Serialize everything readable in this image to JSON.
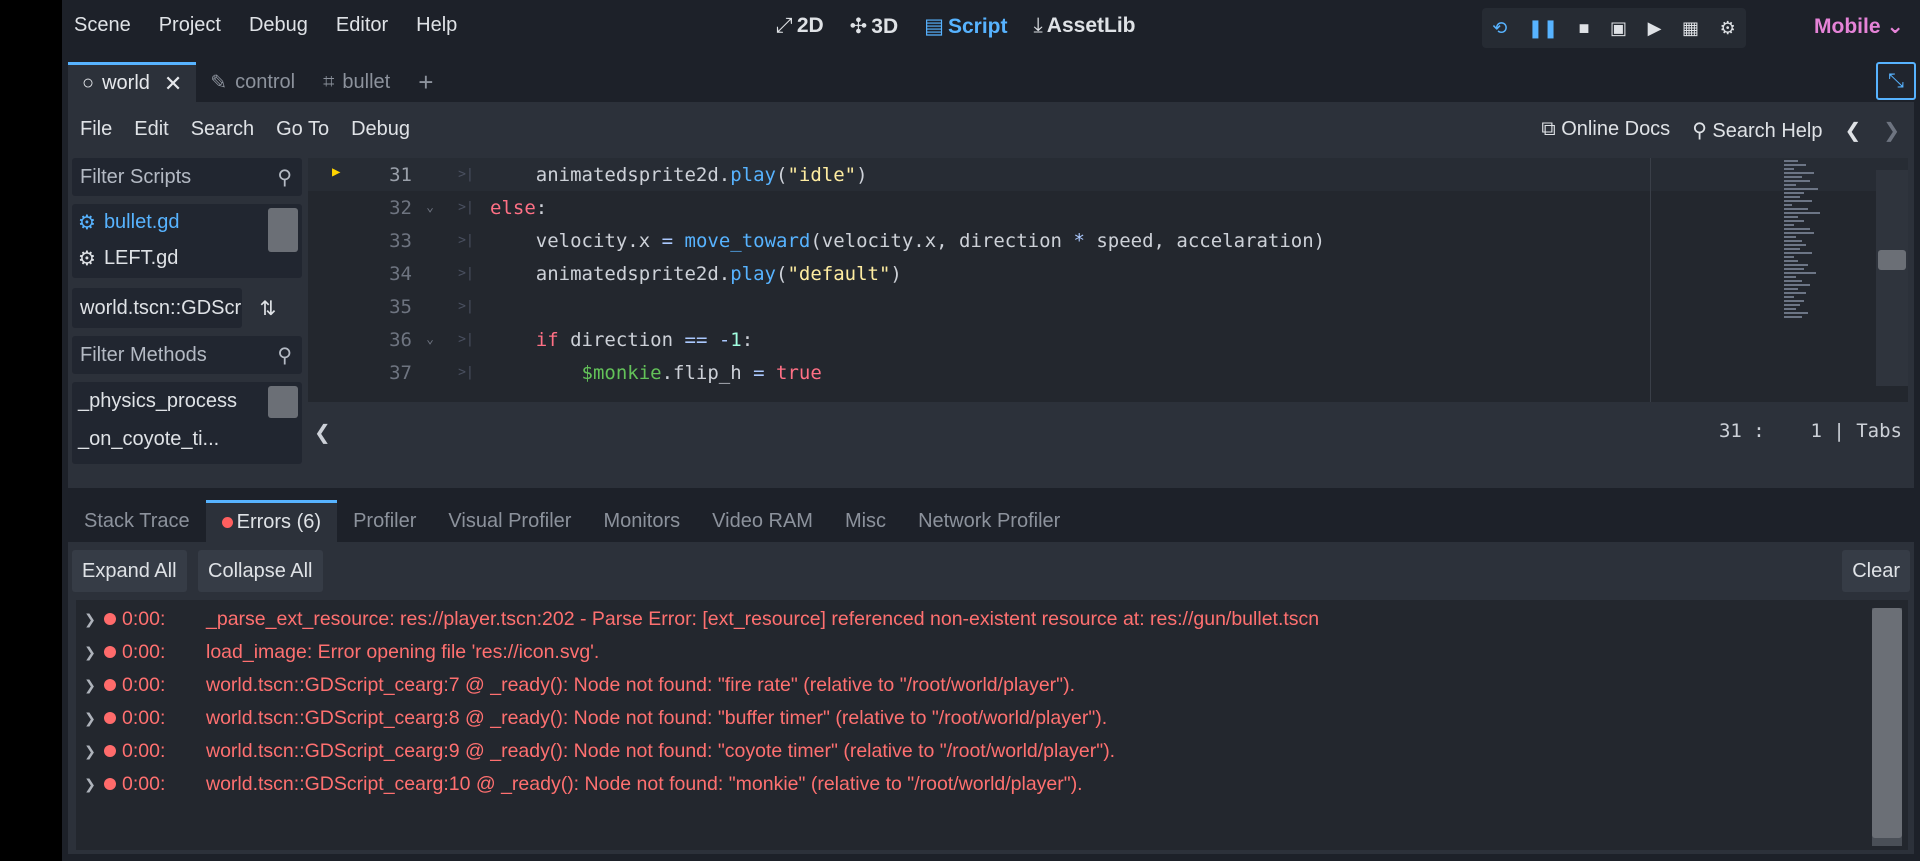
{
  "menu": [
    "Scene",
    "Project",
    "Debug",
    "Editor",
    "Help"
  ],
  "workspaces": [
    {
      "icon": "⤢",
      "label": "2D",
      "active": false
    },
    {
      "icon": "✣",
      "label": "3D",
      "active": false
    },
    {
      "icon": "▤",
      "label": "Script",
      "active": true
    },
    {
      "icon": "⤓",
      "label": "AssetLib",
      "active": false
    }
  ],
  "run_buttons": [
    "⟲",
    "❚❚",
    "■",
    "▣",
    "▶",
    "▦",
    "⚙"
  ],
  "renderer": "Mobile ⌄",
  "tabs": [
    {
      "icon": "○",
      "label": "world",
      "close": "✕",
      "active": true
    },
    {
      "icon": "✎",
      "label": "control",
      "active": false
    },
    {
      "icon": "⌗",
      "label": "bullet",
      "active": false
    }
  ],
  "add_tab": "+",
  "distraction_free": "⤡",
  "script_menu": [
    "File",
    "Edit",
    "Search",
    "Go To",
    "Debug"
  ],
  "right_menu": {
    "online_docs": "Online Docs",
    "search_help": "Search Help",
    "prev": "❮",
    "next": "❯"
  },
  "filter_scripts": {
    "placeholder": "Filter Scripts"
  },
  "scripts": [
    {
      "name": "bullet.gd",
      "selected": true
    },
    {
      "name": "LEFT.gd",
      "selected": false
    }
  ],
  "scene_script": "world.tscn::GDScr",
  "filter_methods": {
    "placeholder": "Filter Methods"
  },
  "methods": [
    "_physics_process",
    "_on_coyote_ti..."
  ],
  "code_lines": [
    {
      "num": "31",
      "fold": "",
      "html": "    animatedsprite2d.<span class='fn'>play</span>(<span class='str'>\"idle\"</span>)",
      "current": true,
      "breakpoint": true
    },
    {
      "num": "32",
      "fold": "⌄",
      "html": "<span class='kw'>else</span>:",
      "current": false
    },
    {
      "num": "33",
      "fold": "",
      "html": "    velocity.x <span class='op'>=</span> <span class='fn'>move_toward</span>(velocity.x, direction <span class='op'>*</span> speed, accelaration)",
      "current": false
    },
    {
      "num": "34",
      "fold": "",
      "html": "    animatedsprite2d.<span class='fn'>play</span>(<span class='str'>\"default\"</span>)",
      "current": false
    },
    {
      "num": "35",
      "fold": "",
      "html": "",
      "current": false
    },
    {
      "num": "36",
      "fold": "⌄",
      "html": "    <span class='kw'>if</span> direction <span class='op'>==</span> <span class='op'>-</span><span class='num'>1</span>:",
      "current": false
    },
    {
      "num": "37",
      "fold": "",
      "html": "        <span class='node'>$monkie</span>.flip_h <span class='op'>=</span> <span class='kw'>true</span>",
      "current": false
    }
  ],
  "status": {
    "left_arrow": "❮",
    "position": "31 :    1 | Tabs"
  },
  "bottom_tabs": [
    {
      "label": "Stack Trace",
      "active": false
    },
    {
      "label": "Errors (6)",
      "active": true,
      "dot": true
    },
    {
      "label": "Profiler",
      "active": false
    },
    {
      "label": "Visual Profiler",
      "active": false
    },
    {
      "label": "Monitors",
      "active": false
    },
    {
      "label": "Video RAM",
      "active": false
    },
    {
      "label": "Misc",
      "active": false
    },
    {
      "label": "Network Profiler",
      "active": false
    }
  ],
  "buttons": {
    "expand_all": "Expand All",
    "collapse_all": "Collapse All",
    "clear": "Clear"
  },
  "errors": [
    {
      "time": "0:00:",
      "message": "_parse_ext_resource: res://player.tscn:202 - Parse Error: [ext_resource] referenced non-existent resource at: res://gun/bullet.tscn"
    },
    {
      "time": "0:00:",
      "message": "load_image: Error opening file 'res://icon.svg'."
    },
    {
      "time": "0:00:",
      "message": "world.tscn::GDScript_cearg:7 @ _ready(): Node not found: \"fire rate\" (relative to \"/root/world/player\")."
    },
    {
      "time": "0:00:",
      "message": "world.tscn::GDScript_cearg:8 @ _ready(): Node not found: \"buffer timer\" (relative to \"/root/world/player\")."
    },
    {
      "time": "0:00:",
      "message": "world.tscn::GDScript_cearg:9 @ _ready(): Node not found: \"coyote timer\" (relative to \"/root/world/player\")."
    },
    {
      "time": "0:00:",
      "message": "world.tscn::GDScript_cearg:10 @ _ready(): Node not found: \"monkie\" (relative to \"/root/world/player\")."
    }
  ],
  "colors": {
    "accent": "#57b3ff",
    "error": "#ff7070",
    "renderer": "#e583d7",
    "background": "#1d2129",
    "panel": "#2c313a"
  }
}
